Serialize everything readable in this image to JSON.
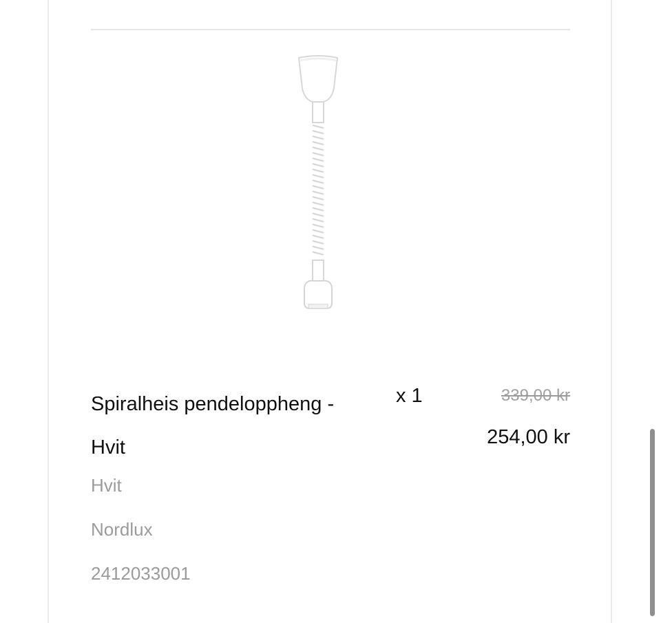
{
  "product": {
    "name": "Spiralheis pendeloppheng - Hvit",
    "quantity": "x 1",
    "original_price": "339,00 kr",
    "price": "254,00 kr",
    "variant": "Hvit",
    "brand": "Nordlux",
    "sku": "2412033001",
    "image_icon": "pendant-spiral-lift-icon"
  }
}
